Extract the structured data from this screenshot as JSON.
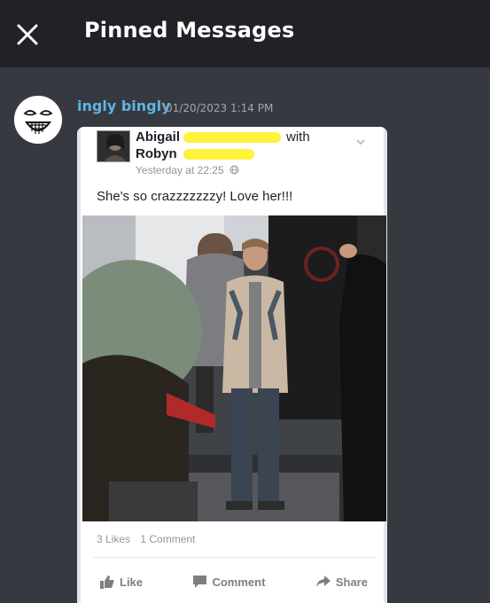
{
  "header": {
    "title": "Pinned Messages",
    "close_icon": "close-icon"
  },
  "message": {
    "author": "ingly bingly",
    "timestamp": "01/20/2023 1:14 PM",
    "author_color": "#5fb3e6",
    "avatar_icon": "grinning-face-sketch-icon"
  },
  "embed": {
    "poster_first": "Abigail",
    "with_label": "with",
    "tagged_first": "Robyn",
    "posted_time": "Yesterday at 22:25",
    "privacy_icon": "globe-icon",
    "post_text": "She's so crazzzzzzzy! Love her!!!",
    "likes": "3 Likes",
    "comments": "1 Comment",
    "actions": {
      "like": "Like",
      "comment": "Comment",
      "share": "Share"
    },
    "redaction_color": "#fdf23c"
  }
}
